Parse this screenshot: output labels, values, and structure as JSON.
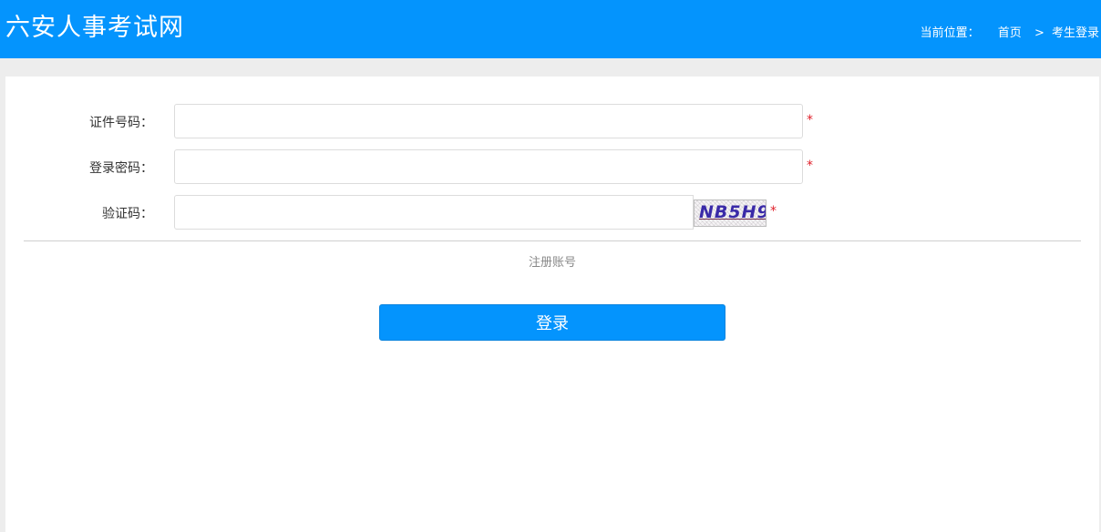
{
  "header": {
    "title": "六安人事考试网",
    "breadcrumb": {
      "label": "当前位置：",
      "home": "首页",
      "separator": ">",
      "current": "考生登录"
    }
  },
  "form": {
    "id_label": "证件号码：",
    "id_value": "",
    "password_label": "登录密码：",
    "password_value": "",
    "captcha_label": "验证码：",
    "captcha_value": "",
    "captcha_image_text": "NB5H9",
    "required_mark": "*",
    "register_link": "注册账号",
    "login_button": "登录"
  },
  "colors": {
    "header_bg": "#0494fd",
    "button_bg": "#0494fd",
    "required": "#e0202a"
  }
}
